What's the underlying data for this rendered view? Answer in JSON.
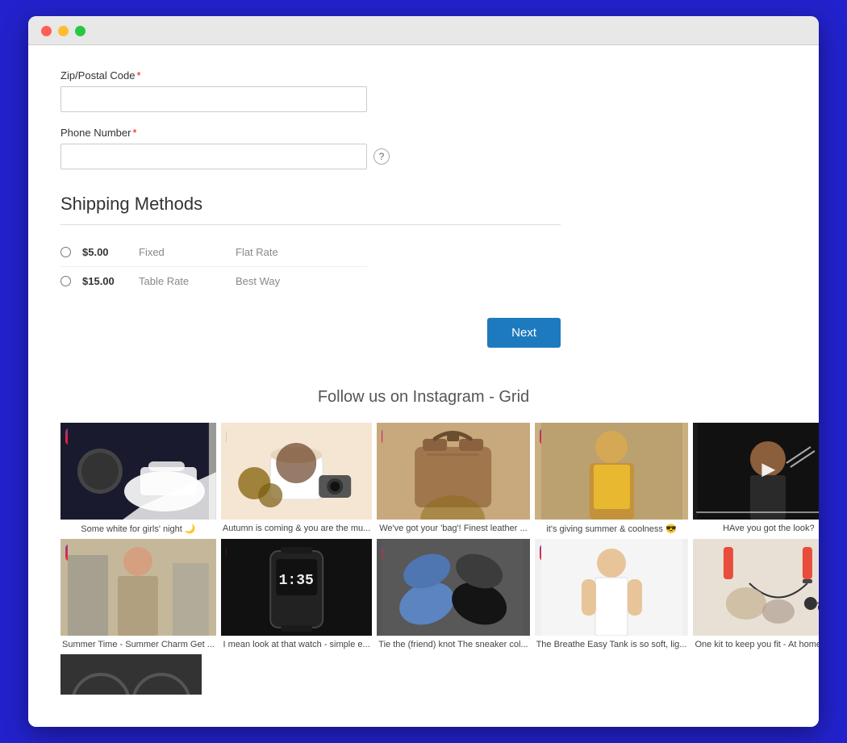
{
  "browser": {
    "traffic_lights": [
      "red",
      "yellow",
      "green"
    ]
  },
  "form": {
    "zip_label": "Zip/Postal Code",
    "zip_required": "*",
    "zip_placeholder": "",
    "phone_label": "Phone Number",
    "phone_required": "*",
    "phone_placeholder": ""
  },
  "shipping": {
    "title": "Shipping Methods",
    "options": [
      {
        "price": "$5.00",
        "type": "Fixed",
        "name": "Flat Rate"
      },
      {
        "price": "$15.00",
        "type": "Table Rate",
        "name": "Best Way"
      }
    ]
  },
  "buttons": {
    "next_label": "Next"
  },
  "instagram": {
    "section_title": "Follow us on Instagram - Grid",
    "items": [
      {
        "caption": "Some white for girls' night 🌙"
      },
      {
        "caption": "Autumn is coming & you are the mu..."
      },
      {
        "caption": "We've got your 'bag'! Finest leather ..."
      },
      {
        "caption": "it's giving summer & coolness 😎"
      },
      {
        "caption": "HAve you got the look?"
      },
      {
        "caption": "Summer Time - Summer Charm Get ..."
      },
      {
        "caption": "I mean look at that watch - simple e..."
      },
      {
        "caption": "Tie the (friend) knot The sneaker col..."
      },
      {
        "caption": "The Breathe Easy Tank is so soft, lig..."
      },
      {
        "caption": "One kit to keep you fit - At home wo..."
      }
    ]
  }
}
